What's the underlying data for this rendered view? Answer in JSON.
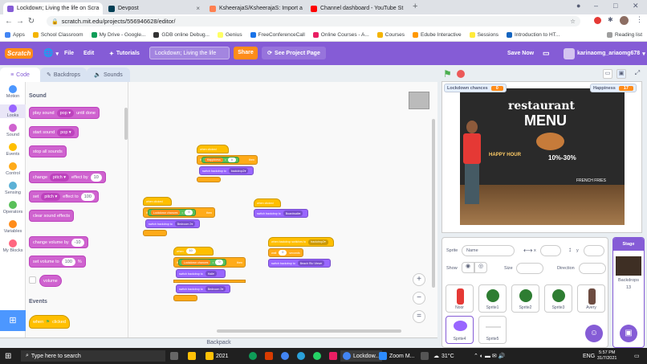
{
  "browser": {
    "tabs": [
      {
        "label": "Lockdown; Living the life on Scra",
        "color": "#855cd6"
      },
      {
        "label": "Devpost",
        "color": "#003e54"
      },
      {
        "label": "KsheerajaS/KsheerajaS: Import a",
        "color": "#ff7f50"
      },
      {
        "label": "Channel dashboard - YouTube St",
        "color": "#ff0000"
      }
    ],
    "new_tab": "+",
    "url": "scratch.mit.edu/projects/556946628/editor/",
    "bookmarks": [
      "Apps",
      "School Classroom",
      "My Drive - Google...",
      "GDB online Debug...",
      "Genius",
      "FreeConferenceCall",
      "Online Courses - A...",
      "Courses",
      "Edube Interactive",
      "Sessions",
      "Introduction to HT..."
    ],
    "reading_list": "Reading list"
  },
  "menubar": {
    "logo": "Scratch",
    "file": "File",
    "edit": "Edit",
    "tutorials": "Tutorials",
    "project_title": "Lockdown; Living the life",
    "share": "Share",
    "see_project": "See Project Page",
    "save_now": "Save Now",
    "username": "karinaomg_ariaomg678"
  },
  "editor_tabs": {
    "code": "Code",
    "backdrops": "Backdrops",
    "sounds": "Sounds"
  },
  "categories": [
    {
      "label": "Motion",
      "color": "#4c97ff"
    },
    {
      "label": "Looks",
      "color": "#9966ff"
    },
    {
      "label": "Sound",
      "color": "#cf63cf"
    },
    {
      "label": "Events",
      "color": "#ffbf00"
    },
    {
      "label": "Control",
      "color": "#ffab19"
    },
    {
      "label": "Sensing",
      "color": "#5cb1d6"
    },
    {
      "label": "Operators",
      "color": "#59c059"
    },
    {
      "label": "Variables",
      "color": "#ff8c1a"
    },
    {
      "label": "My Blocks",
      "color": "#ff6680"
    }
  ],
  "palette": {
    "sound_heading": "Sound",
    "play_sound": "play sound",
    "play_sound_opt": "pop",
    "until_done": "until done",
    "start_sound": "start sound",
    "start_sound_opt": "pop",
    "stop_all": "stop all sounds",
    "change": "change",
    "pitch1": "pitch",
    "effect_by": "effect by",
    "effect_by_val": "10",
    "set": "set",
    "pitch2": "pitch",
    "effect_to": "effect to",
    "effect_to_val": "100",
    "clear_effects": "clear sound effects",
    "change_volume": "change volume by",
    "change_volume_val": "-10",
    "set_volume": "set volume to",
    "set_volume_val": "100",
    "percent": "%",
    "volume": "volume",
    "events_heading": "Events",
    "when": "when",
    "clicked": "clicked"
  },
  "code": {
    "s1": {
      "hat": "when clicked",
      "var": "Happiness",
      "eq": "=",
      "num": "0",
      "then": "then",
      "switch": "switch backdrop to",
      "opt": "backdrop2"
    },
    "s2": {
      "hat": "when clicked",
      "var": "Lockdown chances",
      "eq": "=",
      "num": "0",
      "then": "then",
      "switch": "switch backdrop to",
      "opt": "Bedroom 2"
    },
    "s3": {
      "hat": "when clicked",
      "switch": "switch backdrop to",
      "opt": "Boardwalk"
    },
    "s4": {
      "hat": "when",
      "num": "10",
      "var": "Lockdown chances",
      "eq": "=",
      "num2": "0",
      "then": "then",
      "switch1": "switch backdrop to",
      "opt1": "Hall",
      "switch2": "switch backdrop to",
      "opt2": "Bedroom 3"
    },
    "s5": {
      "hat": "when backdrop switches to",
      "opt": "backdrop2",
      "wait": "wait",
      "secs": "0",
      "seconds": "seconds",
      "switch": "switch backdrop to",
      "opt2": "Beach Rio View"
    },
    "zoom_in": "+",
    "zoom_out": "−",
    "zoom_reset": "="
  },
  "backpack": "Backpack",
  "stage": {
    "monitors": [
      {
        "label": "Lockdown chances",
        "value": "0"
      },
      {
        "label": "Happiness",
        "value": "17"
      }
    ],
    "sign1": "restaurant",
    "sign2": "MENU",
    "sign3": "HAPPY HOUR",
    "sign4": "10%-30%",
    "sign5": "FRENCH FRIES"
  },
  "sprite_info": {
    "sprite": "Sprite",
    "name_placeholder": "Name",
    "x": "x",
    "y": "y",
    "show": "Show",
    "size": "Size",
    "direction": "Direction"
  },
  "sprites": [
    "Noor",
    "Sprite1",
    "Sprite2",
    "Sprite3",
    "Avery",
    "Sprite4",
    "Sprite5"
  ],
  "stage_pane": {
    "title": "Stage",
    "backdrops": "Backdrops",
    "count": "13"
  },
  "taskbar": {
    "search": "Type here to search",
    "weather": "31°C",
    "lang": "ENG",
    "time": "5:57 PM",
    "date": "31/7/2021",
    "apps": [
      "2021",
      "Lockdow...",
      "Zoom M..."
    ]
  }
}
